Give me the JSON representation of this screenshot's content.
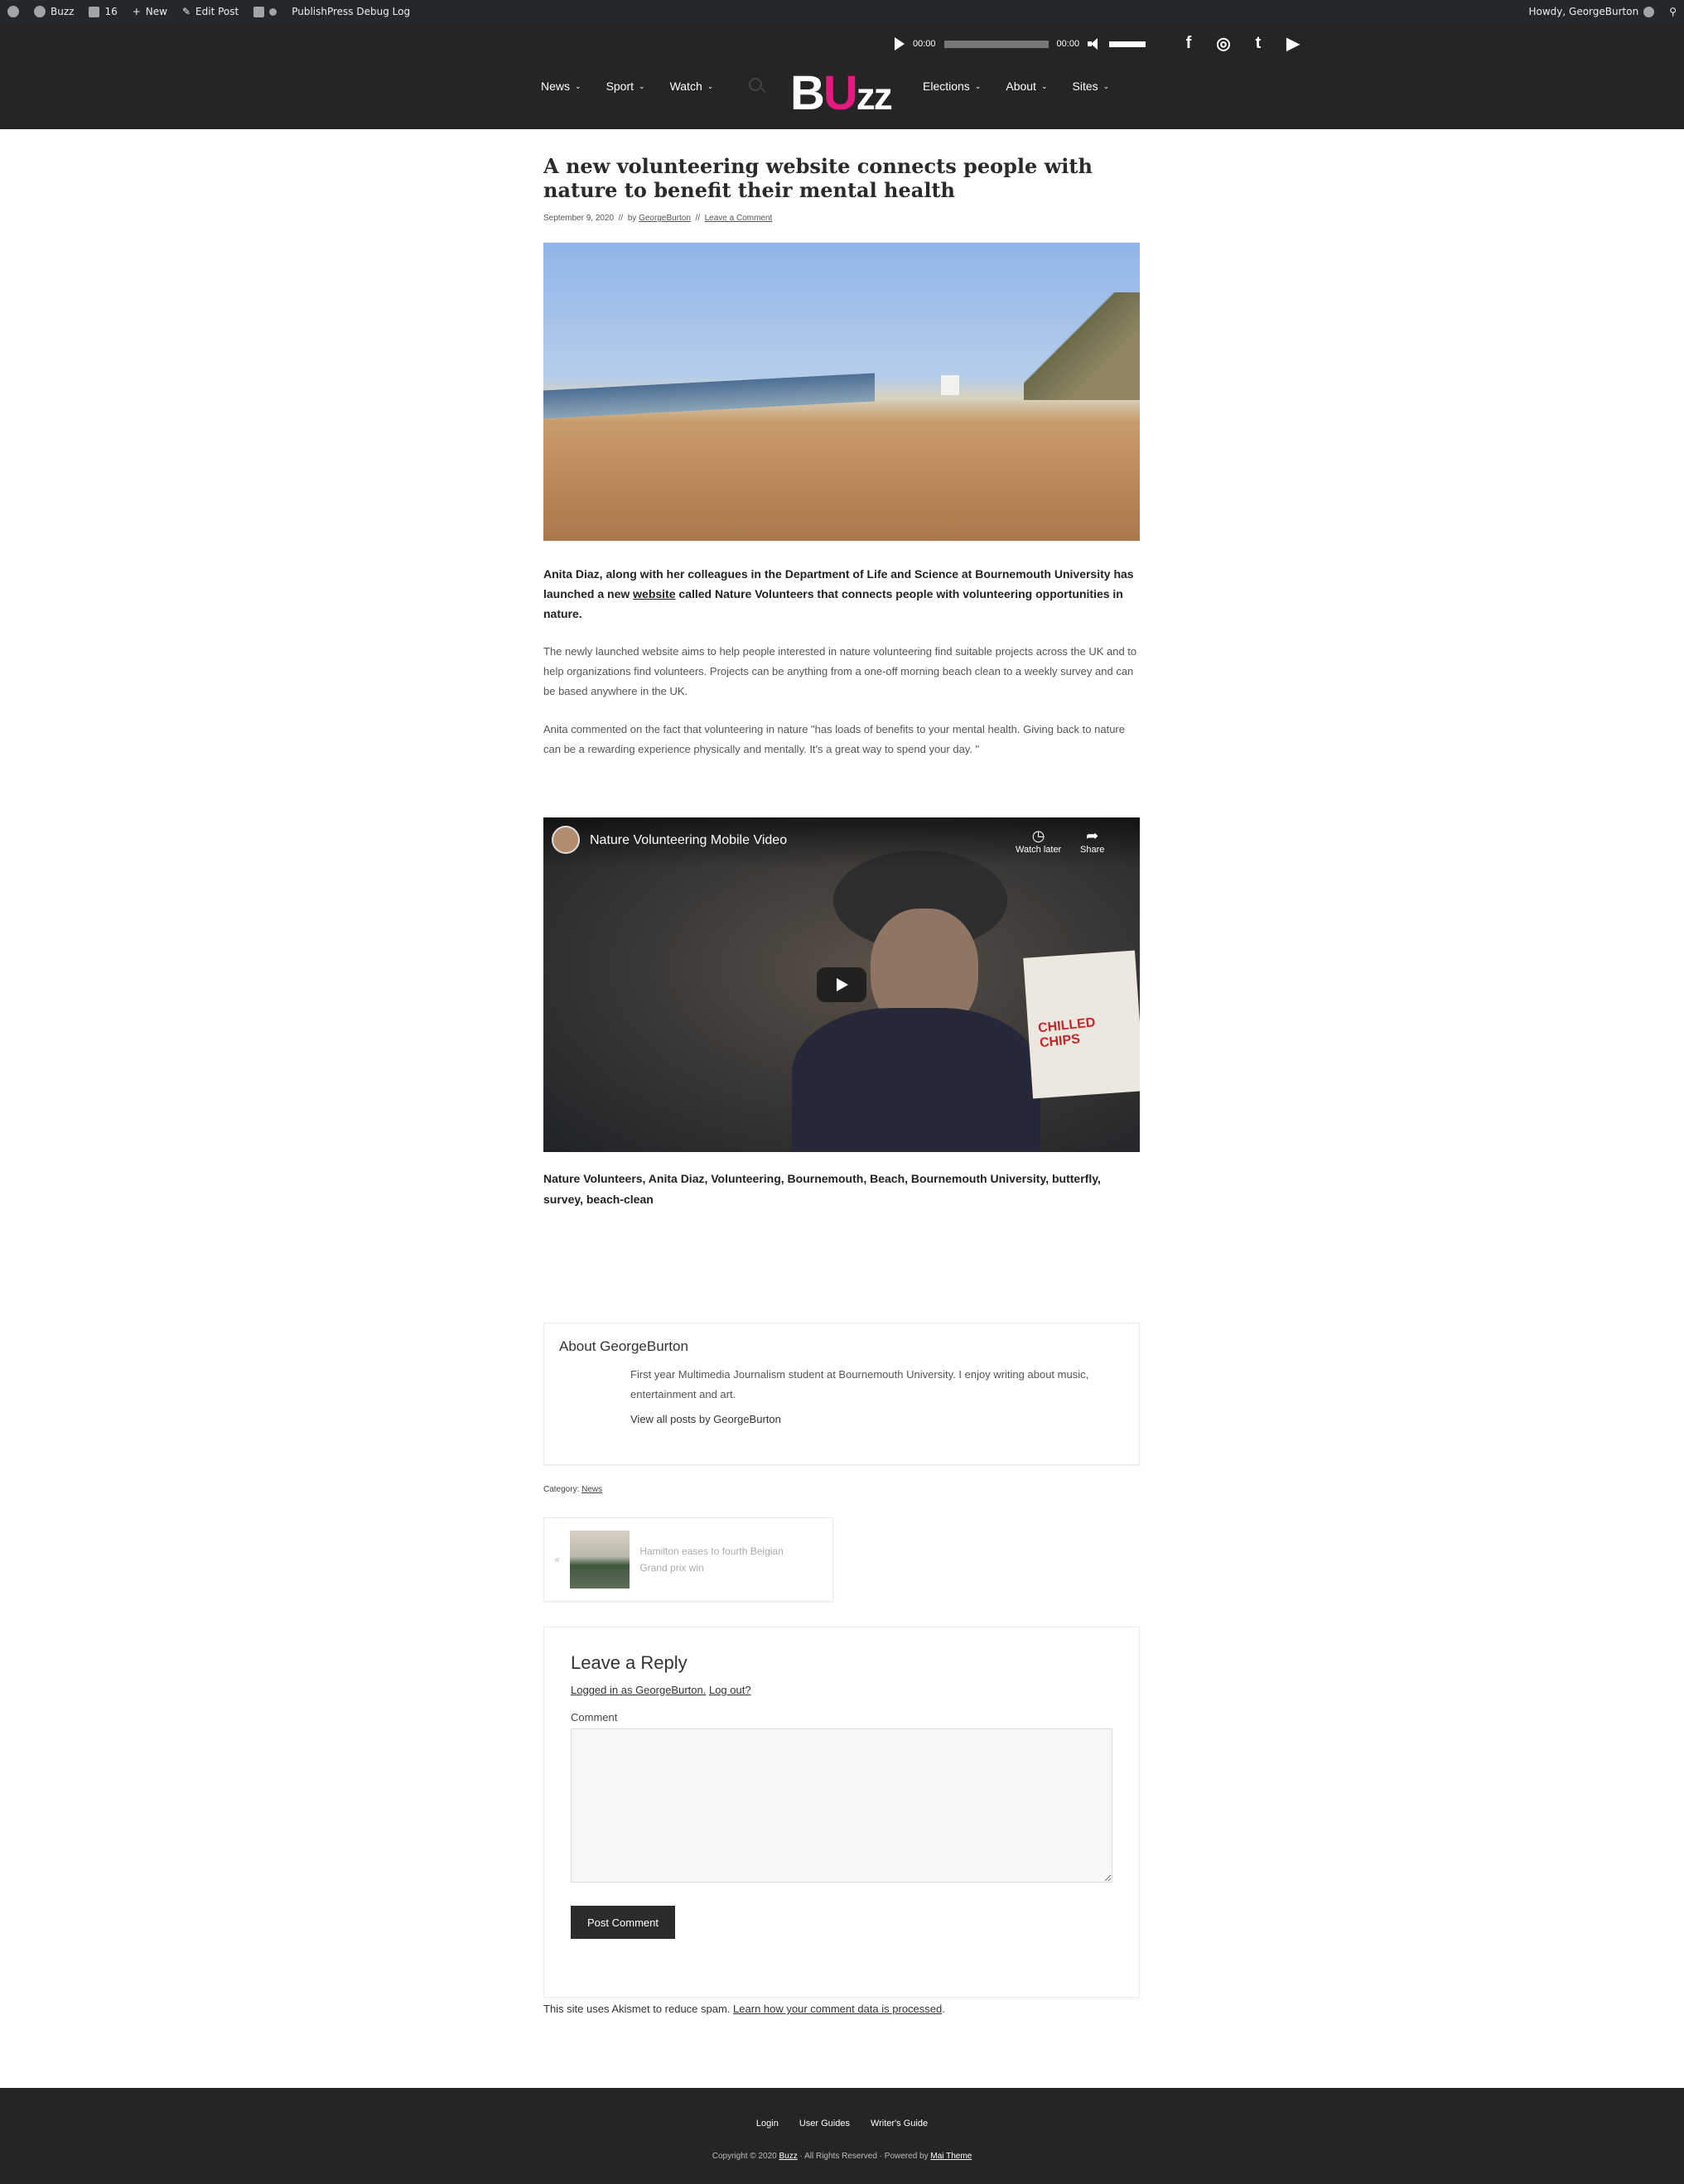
{
  "adminbar": {
    "site_name": "Buzz",
    "comments_count": "16",
    "new_label": "New",
    "edit_label": "Edit Post",
    "debug_label": "PublishPress Debug Log",
    "howdy": "Howdy, GeorgeBurton"
  },
  "player": {
    "current_time": "00:00",
    "total_time": "00:00"
  },
  "nav": {
    "left": [
      "News",
      "Sport",
      "Watch"
    ],
    "right": [
      "Elections",
      "About",
      "Sites"
    ]
  },
  "logo": {
    "b": "B",
    "u": "U",
    "zz": "zz",
    "accent_color": "#e6197e"
  },
  "social": {
    "facebook": "f",
    "instagram": "◎",
    "twitter": "t",
    "youtube": "▶"
  },
  "article": {
    "title": "A new volunteering website connects people with nature to benefit their mental health",
    "date": "September 9, 2020",
    "by": "by",
    "author": "GeorgeBurton",
    "comment_link": "Leave a Comment",
    "lead_before": "Anita Diaz, along with her colleagues in the Department of Life and Science at Bournemouth University has launched a new ",
    "lead_link": "website",
    "lead_after": " called Nature Volunteers that connects people with volunteering opportunities in nature.",
    "para1": "The newly launched website aims to help people interested in nature volunteering find suitable projects across the UK and to help organizations find volunteers. Projects can be anything from a one-off morning beach clean to a weekly  survey and can be based anywhere in the UK.",
    "para2": "Anita commented on the fact that volunteering in nature \"has loads of benefits to your mental health. Giving back to nature can be a rewarding experience physically and mentally. It's a great way to spend your day. \"",
    "video_title": "Nature Volunteering Mobile Video",
    "video_watch_later": "Watch later",
    "video_share": "Share",
    "video_box_label": "CHILLED CHIPS",
    "tags": "Nature Volunteers, Anita Diaz, Volunteering, Bournemouth, Beach, Bournemouth University, butterfly, survey, beach-clean"
  },
  "author_box": {
    "heading": "About GeorgeBurton",
    "bio": "First year Multimedia Journalism student at Bournemouth University. I enjoy writing about music, entertainment and art.",
    "view_all": "View all posts by GeorgeBurton"
  },
  "category": {
    "label": "Category:",
    "value": "News"
  },
  "prev_post": {
    "arrow": "«",
    "title": "Hamilton eases to fourth Belgian Grand prix win"
  },
  "reply": {
    "heading": "Leave a Reply",
    "logged_in": "Logged in as GeorgeBurton.",
    "logout": "Log out?",
    "comment_label": "Comment",
    "submit": "Post Comment"
  },
  "akismet": {
    "text": "This site uses Akismet to reduce spam. ",
    "link": "Learn how your comment data is processed",
    "end": "."
  },
  "footer": {
    "links": [
      "Login",
      "User Guides",
      "Writer's Guide"
    ],
    "copy_before": "Copyright © 2020 ",
    "copy_site": "Buzz",
    "copy_middle": " · All Rights Reserved · Powered by ",
    "copy_theme": "Mai Theme"
  }
}
